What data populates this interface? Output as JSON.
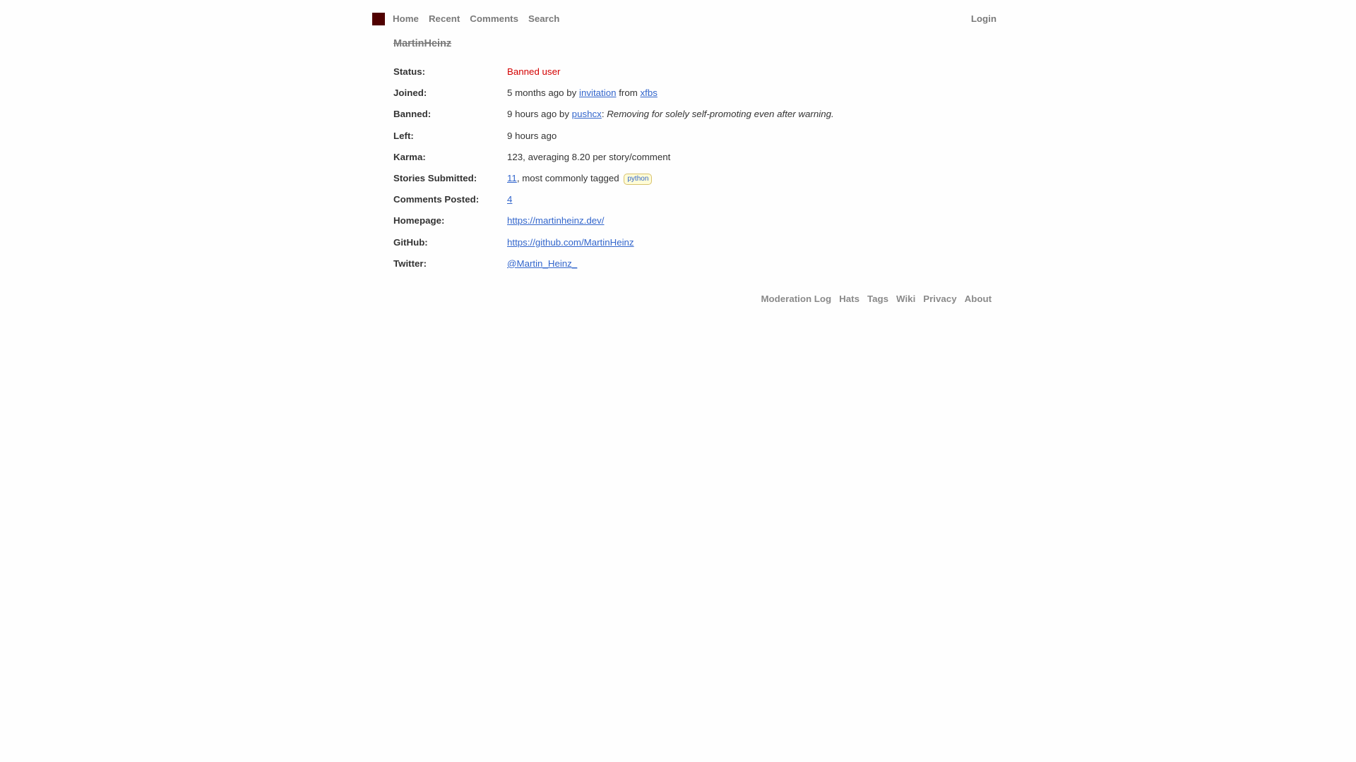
{
  "nav": {
    "home": "Home",
    "recent": "Recent",
    "comments": "Comments",
    "search": "Search",
    "login": "Login"
  },
  "profile": {
    "username": "MartinHeinz",
    "status_label": "Status:",
    "status_value": "Banned user",
    "joined_label": "Joined:",
    "joined_prefix": "5 months ago by ",
    "joined_link": "invitation",
    "joined_mid": " from ",
    "joined_inviter": "xfbs",
    "banned_label": "Banned:",
    "banned_prefix": "9 hours ago by ",
    "banned_by": "pushcx",
    "banned_colon": ": ",
    "banned_reason": "Removing for solely self-promoting even after warning.",
    "left_label": "Left:",
    "left_value": "9 hours ago",
    "karma_label": "Karma:",
    "karma_value": "123, averaging 8.20 per story/comment",
    "stories_label": "Stories Submitted:",
    "stories_count": "11",
    "stories_suffix": ", most commonly tagged ",
    "stories_tag": "python",
    "comments_label": "Comments Posted:",
    "comments_count": "4",
    "homepage_label": "Homepage:",
    "homepage_value": "https://martinheinz.dev/",
    "github_label": "GitHub:",
    "github_value": "https://github.com/MartinHeinz",
    "twitter_label": "Twitter:",
    "twitter_value": "@Martin_Heinz_"
  },
  "footer": {
    "moderation_log": "Moderation Log",
    "hats": "Hats",
    "tags": "Tags",
    "wiki": "Wiki",
    "privacy": "Privacy",
    "about": "About"
  },
  "colors": {
    "logo": "#500000",
    "link": "#3366cc",
    "banned": "#d40000",
    "tag_bg": "#fffcd7",
    "tag_border": "#d8c26e"
  }
}
